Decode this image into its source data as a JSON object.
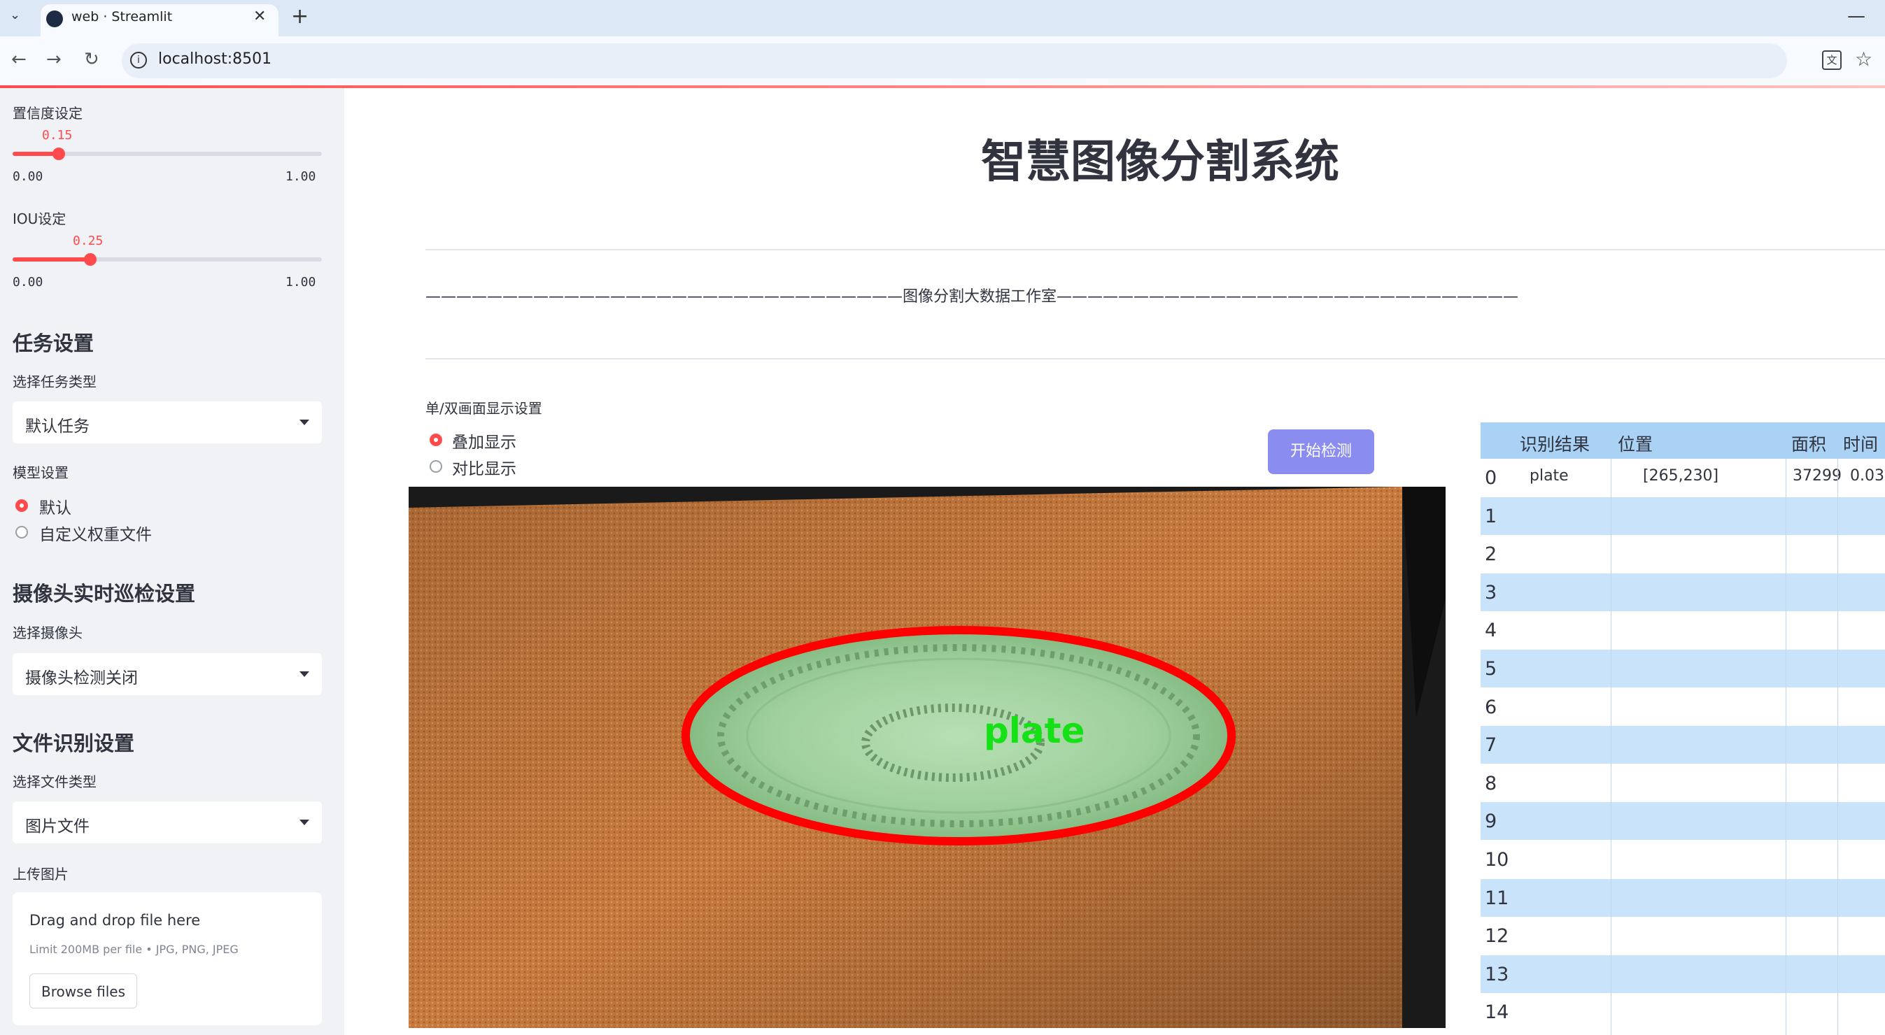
{
  "browser": {
    "tab_title": "web · Streamlit",
    "url": "localhost:8501"
  },
  "sidebar": {
    "confidence": {
      "label": "置信度设定",
      "value": "0.15",
      "value_fraction": 0.15,
      "min": "0.00",
      "max": "1.00"
    },
    "iou": {
      "label": "IOU设定",
      "value": "0.25",
      "value_fraction": 0.25,
      "min": "0.00",
      "max": "1.00"
    },
    "task_heading": "任务设置",
    "task_type_label": "选择任务类型",
    "task_type_value": "默认任务",
    "model_label": "模型设置",
    "model_options": [
      "默认",
      "自定义权重文件"
    ],
    "camera_heading": "摄像头实时巡检设置",
    "camera_label": "选择摄像头",
    "camera_value": "摄像头检测关闭",
    "file_heading": "文件识别设置",
    "file_type_label": "选择文件类型",
    "file_type_value": "图片文件",
    "upload_label": "上传图片",
    "upload_title": "Drag and drop file here",
    "upload_limit": "Limit 200MB per file • JPG, PNG, JPEG",
    "browse_label": "Browse files"
  },
  "main": {
    "title": "智慧图像分割系统",
    "studio_line": "———————————————————————————————图像分割大数据工作室——————————————————————————————",
    "display_label": "单/双画面显示设置",
    "display_options": [
      "叠加显示",
      "对比显示"
    ],
    "detect_button": "开始检测",
    "image_label": "plate"
  },
  "table": {
    "headers": [
      "识别结果",
      "位置",
      "面积",
      "时间"
    ],
    "rows": [
      {
        "idx": "0",
        "result": "plate",
        "pos": "[265,230]",
        "area": "37299",
        "time": "0.03"
      },
      {
        "idx": "1"
      },
      {
        "idx": "2"
      },
      {
        "idx": "3"
      },
      {
        "idx": "4"
      },
      {
        "idx": "5"
      },
      {
        "idx": "6"
      },
      {
        "idx": "7"
      },
      {
        "idx": "8"
      },
      {
        "idx": "9"
      },
      {
        "idx": "10"
      },
      {
        "idx": "11"
      },
      {
        "idx": "12"
      },
      {
        "idx": "13"
      },
      {
        "idx": "14"
      }
    ]
  },
  "colors": {
    "accent": "#ff4b4b",
    "button": "#8b8cf0",
    "table_header": "#a9d2f5",
    "table_alt": "#c8e3fa"
  }
}
